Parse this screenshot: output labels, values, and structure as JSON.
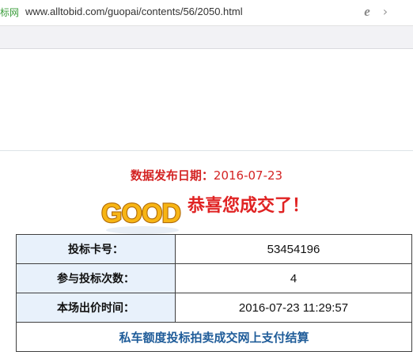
{
  "browser": {
    "site_tag": "标网",
    "url": "www.alltobid.com/guopai/contents/56/2050.html"
  },
  "release": {
    "label": "数据发布日期：",
    "date": "2016-07-23"
  },
  "banner": {
    "badge_text": "GOOD",
    "message": "恭喜您成交了！"
  },
  "result_table": {
    "rows": [
      {
        "label": "投标卡号：",
        "value": "53454196"
      },
      {
        "label": "参与投标次数：",
        "value": "4"
      },
      {
        "label": "本场出价时间：",
        "value": "2016-07-23 11:29:57"
      }
    ],
    "payment_link": "私车额度投标拍卖成交网上支付结算"
  },
  "colors": {
    "accent_red": "#d42424",
    "link_blue": "#1f5c99",
    "label_bg": "#e8f1fb",
    "badge_yellow": "#f7b514"
  }
}
